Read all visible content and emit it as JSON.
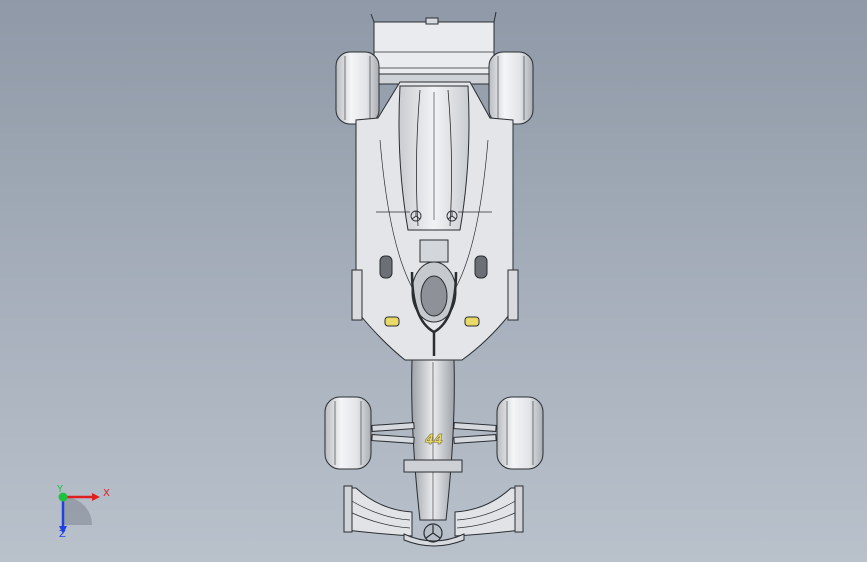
{
  "viewport": {
    "view": "top",
    "background_top": "#8f99a7",
    "background_bottom": "#b9c1cb"
  },
  "model": {
    "subject": "formula-one-car",
    "car_number": "44",
    "logo_icon": "mercedes-star-icon",
    "body_color": "#e6e8eb",
    "edge_color": "#2a2d31",
    "accent_color": "#e9d86a"
  },
  "triad": {
    "x_label": "X",
    "y_label": "Y",
    "z_label": "Z",
    "x_color": "#e02020",
    "y_color": "#20c040",
    "z_color": "#2040e0"
  }
}
